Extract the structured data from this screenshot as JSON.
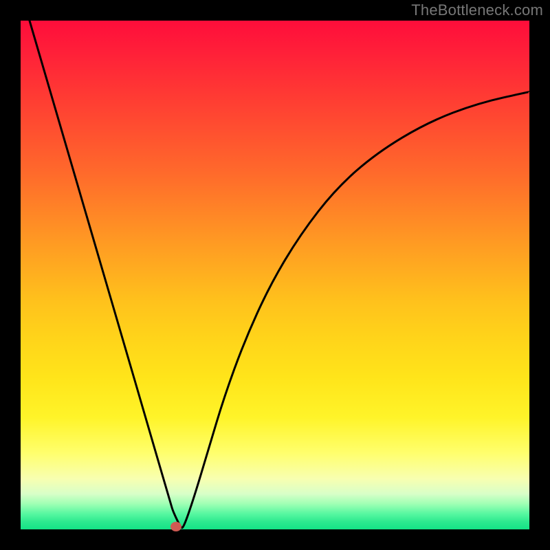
{
  "watermark": "TheBottleneck.com",
  "chart_data": {
    "type": "line",
    "title": "",
    "xlabel": "",
    "ylabel": "",
    "xlim": [
      0,
      1
    ],
    "ylim": [
      0,
      1
    ],
    "grid": false,
    "legend": false,
    "background_gradient": {
      "stops": [
        {
          "pos": 0.0,
          "color": "#ff0d3a"
        },
        {
          "pos": 0.3,
          "color": "#ff6a2b"
        },
        {
          "pos": 0.55,
          "color": "#ffc11c"
        },
        {
          "pos": 0.78,
          "color": "#fff429"
        },
        {
          "pos": 0.93,
          "color": "#d9ffc8"
        },
        {
          "pos": 1.0,
          "color": "#14e286"
        }
      ]
    },
    "marker": {
      "x": 0.305,
      "y": 0.0,
      "color": "#cf5a53"
    },
    "series": [
      {
        "name": "curve",
        "color": "#000000",
        "x": [
          0.0,
          0.05,
          0.1,
          0.15,
          0.2,
          0.25,
          0.285,
          0.295,
          0.3,
          0.315,
          0.32,
          0.34,
          0.37,
          0.4,
          0.44,
          0.49,
          0.55,
          0.62,
          0.7,
          0.8,
          0.9,
          1.0
        ],
        "values": [
          1.06,
          0.889,
          0.718,
          0.547,
          0.376,
          0.205,
          0.085,
          0.051,
          0.034,
          0.003,
          0.003,
          0.06,
          0.16,
          0.26,
          0.37,
          0.48,
          0.58,
          0.67,
          0.74,
          0.8,
          0.838,
          0.86
        ]
      }
    ]
  }
}
